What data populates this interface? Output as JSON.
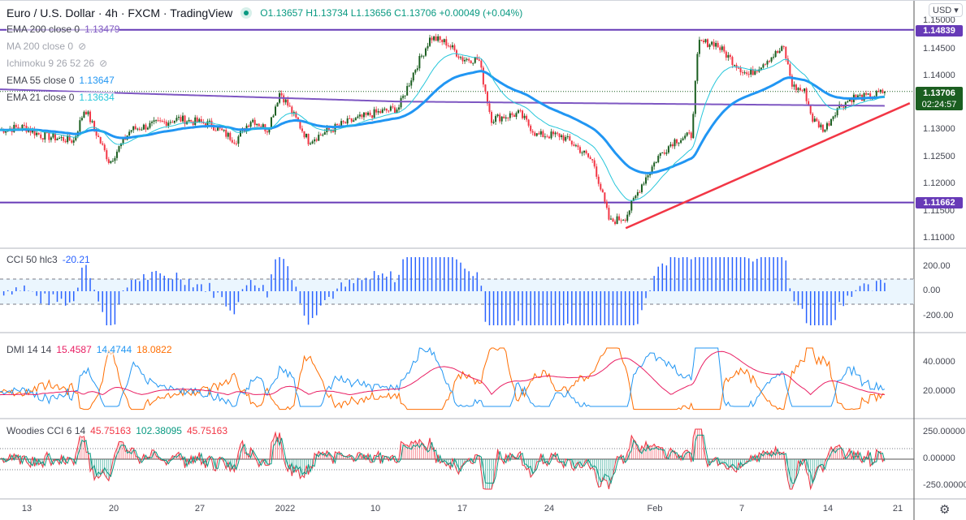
{
  "header": {
    "title": "Euro / U.S. Dollar · 4h · FXCM · TradingView",
    "ohlc": "O1.13657 H1.13734 L1.13656 C1.13706 +0.00049 (+0.04%)",
    "currency": "USD"
  },
  "legends": [
    {
      "label": "EMA 200 close 0",
      "value": "1.13479",
      "color": "#7e57c2"
    },
    {
      "label": "MA 200 close 0",
      "hidden": true
    },
    {
      "label": "Ichimoku 9 26 52 26",
      "hidden": true
    },
    {
      "label": "EMA 55 close 0",
      "value": "1.13647",
      "color": "#2196f3"
    },
    {
      "label": "EMA 21 close 0",
      "value": "1.13634",
      "color": "#26c6da"
    }
  ],
  "cci": {
    "label": "CCI 50 hlc3",
    "value": "-20.21",
    "color": "#2962ff",
    "axis": [
      "200.00",
      "0.00",
      "-200.00"
    ]
  },
  "dmi": {
    "label": "DMI 14 14",
    "values": [
      "15.4587",
      "14.4744",
      "18.0822"
    ],
    "colors": [
      "#e91e63",
      "#2196f3",
      "#ff6d00"
    ],
    "axis": [
      "40.0000",
      "20.0000"
    ]
  },
  "woodies": {
    "label": "Woodies CCI 6 14",
    "values": [
      "45.75163",
      "102.38095",
      "45.75163"
    ],
    "colors": [
      "#f23645",
      "#089981",
      "#f23645"
    ],
    "axis": [
      "250.00000",
      "0.00000",
      "-250.00000"
    ]
  },
  "price_axis": [
    "1.15000",
    "1.14500",
    "1.14000",
    "1.13000",
    "1.12500",
    "1.12000",
    "1.11500",
    "1.11000"
  ],
  "badges": {
    "resistance": "1.14839",
    "support": "1.11662",
    "last": "1.13706",
    "countdown": "02:24:57"
  },
  "time_axis": [
    "13",
    "20",
    "27",
    "2022",
    "10",
    "17",
    "24",
    "Feb",
    "7",
    "14",
    "21"
  ],
  "chart_data": {
    "type": "candlestick",
    "title": "Euro / U.S. Dollar 4h",
    "x_unit": "days since 13 Dec 2021",
    "ylim": [
      1.108,
      1.151
    ],
    "close_path": [
      [
        -2.2,
        1.13
      ],
      [
        -0.2,
        1.1305
      ],
      [
        1.1,
        1.129
      ],
      [
        3.8,
        1.128
      ],
      [
        4.7,
        1.134
      ],
      [
        6.7,
        1.124
      ],
      [
        8.4,
        1.13
      ],
      [
        10.3,
        1.131
      ],
      [
        12.3,
        1.132
      ],
      [
        14.9,
        1.131
      ],
      [
        16.9,
        1.128
      ],
      [
        18.2,
        1.132
      ],
      [
        19.5,
        1.13
      ],
      [
        20.5,
        1.137
      ],
      [
        22.8,
        1.128
      ],
      [
        25.5,
        1.131
      ],
      [
        28.1,
        1.133
      ],
      [
        30.1,
        1.134
      ],
      [
        31.4,
        1.141
      ],
      [
        32.7,
        1.147
      ],
      [
        34.0,
        1.146
      ],
      [
        35.3,
        1.143
      ],
      [
        36.6,
        1.143
      ],
      [
        37.6,
        1.132
      ],
      [
        39.9,
        1.133
      ],
      [
        41.3,
        1.129
      ],
      [
        43.2,
        1.129
      ],
      [
        44.5,
        1.127
      ],
      [
        45.9,
        1.124
      ],
      [
        47.2,
        1.113
      ],
      [
        48.5,
        1.114
      ],
      [
        49.8,
        1.12
      ],
      [
        51.1,
        1.125
      ],
      [
        52.4,
        1.128
      ],
      [
        53.8,
        1.129
      ],
      [
        54.4,
        1.146
      ],
      [
        55.7,
        1.146
      ],
      [
        57.0,
        1.143
      ],
      [
        58.4,
        1.14
      ],
      [
        60.0,
        1.143
      ],
      [
        61.3,
        1.145
      ],
      [
        62.0,
        1.138
      ],
      [
        63.0,
        1.137
      ],
      [
        63.6,
        1.132
      ],
      [
        64.6,
        1.13
      ],
      [
        65.6,
        1.134
      ],
      [
        66.9,
        1.136
      ],
      [
        68.2,
        1.136
      ],
      [
        69.5,
        1.13706
      ]
    ],
    "horizontal_levels": [
      1.14839,
      1.11662
    ],
    "trendline": [
      [
        48.5,
        1.1119
      ],
      [
        71.5,
        1.1349
      ]
    ],
    "last_price": 1.13706
  }
}
